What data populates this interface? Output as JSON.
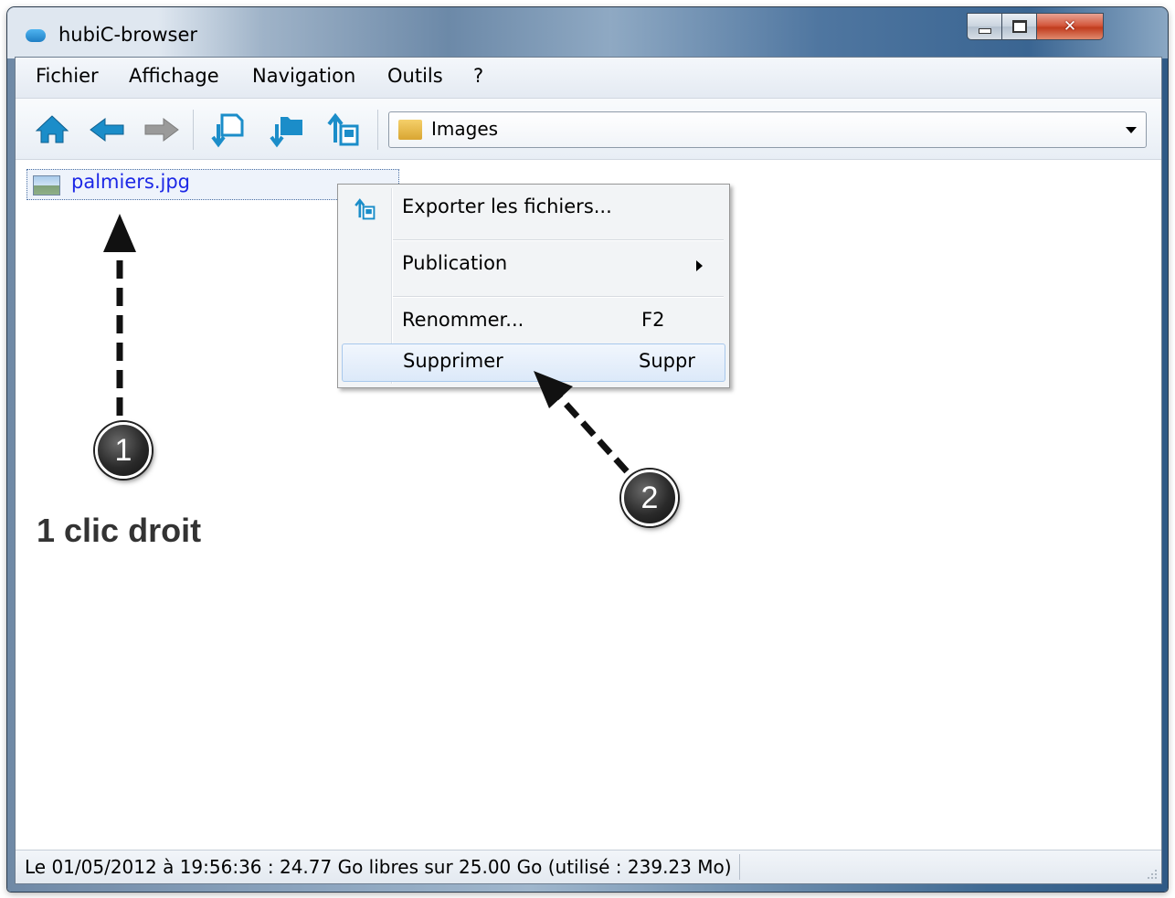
{
  "window": {
    "title": "hubiC-browser"
  },
  "menubar": {
    "items": [
      "Fichier",
      "Affichage",
      "Navigation",
      "Outils",
      "?"
    ]
  },
  "toolbar": {
    "icons": [
      "home-icon",
      "back-arrow-icon",
      "forward-arrow-icon",
      "download-file-icon",
      "download-folder-icon",
      "export-icon"
    ],
    "path_combo": {
      "value": "Images",
      "icon": "folder-icon"
    }
  },
  "file_list": {
    "items": [
      {
        "name": "palmiers.jpg",
        "icon": "image-file-icon",
        "selected": true
      }
    ]
  },
  "context_menu": {
    "items": [
      {
        "label": "Exporter les fichiers...",
        "shortcut": "",
        "icon": "export-icon"
      },
      {
        "label": "Publication",
        "shortcut": "",
        "has_submenu": true
      },
      {
        "label": "Renommer...",
        "shortcut": "F2"
      },
      {
        "label": "Supprimer",
        "shortcut": "Suppr",
        "highlighted": true
      }
    ]
  },
  "statusbar": {
    "text": "Le 01/05/2012 à 19:56:36 : 24.77 Go libres sur 25.00 Go (utilisé : 239.23 Mo)"
  },
  "annotations": {
    "badge_1": "1",
    "badge_2": "2",
    "caption": "1 clic droit"
  },
  "colors": {
    "link_blue": "#1c27e6",
    "toolbar_icon_blue": "#1b8dc9",
    "disabled_gray": "#9a9a9a",
    "close_red": "#c8432a"
  }
}
